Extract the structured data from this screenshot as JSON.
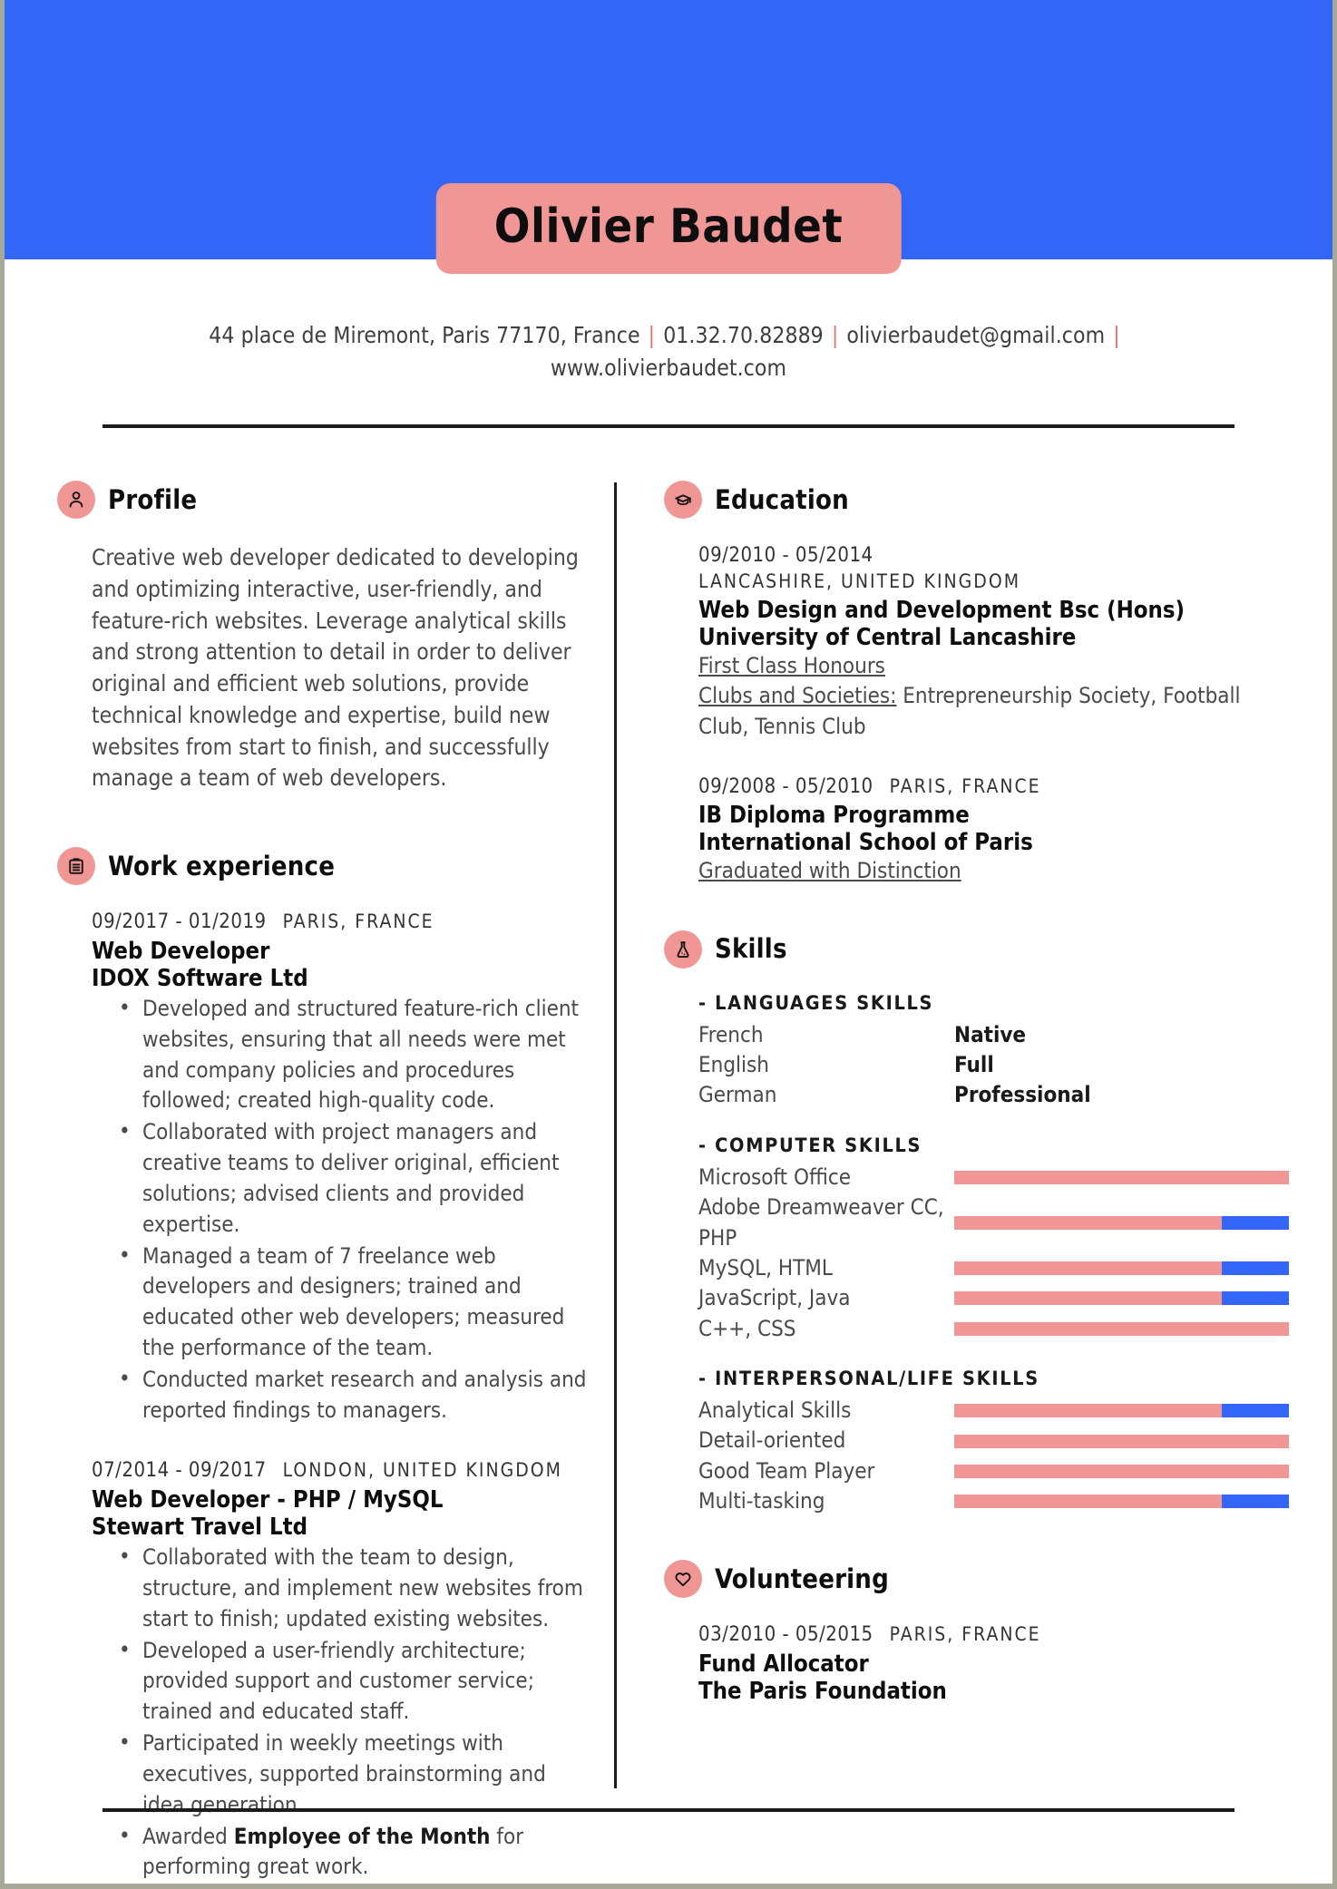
{
  "theme": {
    "accent_blue": "#3366f6",
    "accent_pink": "#f09694",
    "text_dark": "#0e0e0e",
    "text_body": "#4a4a4a",
    "separator_pink": "#e5706d"
  },
  "header": {
    "name": "Olivier Baudet",
    "contact": {
      "address": "44 place de Miremont, Paris 77170, France",
      "phone": "01.32.70.82889",
      "email": "olivierbaudet@gmail.com",
      "website": "www.olivierbaudet.com",
      "separator": "|"
    }
  },
  "profile": {
    "heading": "Profile",
    "icon": "person-icon",
    "text": "Creative web developer dedicated to developing and optimizing interactive, user-friendly, and feature-rich websites. Leverage analytical skills and strong attention to detail in order to deliver original and efficient web solutions, provide technical knowledge and expertise, build new websites from start to finish, and successfully manage a team of web developers."
  },
  "work_experience": {
    "heading": "Work experience",
    "icon": "briefcase-icon",
    "entries": [
      {
        "dates": "09/2017 - 01/2019",
        "location": "PARIS, FRANCE",
        "title": "Web Developer",
        "organization": "IDOX Software Ltd",
        "bullets": [
          {
            "text": "Developed and structured feature-rich client websites, ensuring that all needs were met and company policies and procedures followed; created high-quality code."
          },
          {
            "text": "Collaborated with project managers and creative teams to deliver original, efficient solutions; advised clients and provided expertise."
          },
          {
            "text": "Managed a team of 7 freelance web developers and designers; trained and educated other web developers; measured the performance of the team."
          },
          {
            "text": "Conducted market research and analysis and reported findings to managers."
          }
        ]
      },
      {
        "dates": "07/2014 - 09/2017",
        "location": "LONDON, UNITED KINGDOM",
        "title": "Web Developer - PHP / MySQL",
        "organization": "Stewart Travel Ltd",
        "bullets": [
          {
            "text": "Collaborated with the team to design, structure, and implement new websites from start to finish; updated existing websites."
          },
          {
            "text": "Developed a user-friendly architecture; provided support and customer service; trained and educated staff."
          },
          {
            "text": "Participated in weekly meetings with executives, supported brainstorming and idea generation."
          },
          {
            "pre": "Awarded ",
            "bold": "Employee of the Month",
            "post": " for performing great work."
          }
        ]
      }
    ]
  },
  "education": {
    "heading": "Education",
    "icon": "graduation-cap-icon",
    "entries": [
      {
        "dates": "09/2010 - 05/2014",
        "location": "LANCASHIRE, UNITED KINGDOM",
        "location_block": true,
        "title": "Web Design and Development Bsc (Hons)",
        "organization": "University of Central Lancashire",
        "note_1_underline": "First Class Honours",
        "note_2_underline": "Clubs and Societies:",
        "note_2_rest": " Entrepreneurship Society, Football Club, Tennis Club"
      },
      {
        "dates": "09/2008 - 05/2010",
        "location": "PARIS, FRANCE",
        "location_block": false,
        "title": "IB Diploma Programme",
        "organization": "International School of Paris",
        "note_1_underline": "Graduated with Distinction"
      }
    ]
  },
  "skills": {
    "heading": "Skills",
    "icon": "flask-icon",
    "groups": [
      {
        "title": "- LANGUAGES SKILLS",
        "type": "level",
        "items": [
          {
            "name": "French",
            "level": "Native"
          },
          {
            "name": "English",
            "level": "Full"
          },
          {
            "name": "German",
            "level": "Professional"
          }
        ]
      },
      {
        "title": "- COMPUTER SKILLS",
        "type": "bar",
        "items": [
          {
            "name": "Microsoft Office",
            "percent": 100
          },
          {
            "name": "Adobe Dreamweaver CC, PHP",
            "percent": 80
          },
          {
            "name": "MySQL, HTML",
            "percent": 80
          },
          {
            "name": "JavaScript, Java",
            "percent": 80
          },
          {
            "name": "C++, CSS",
            "percent": 100
          }
        ]
      },
      {
        "title": "- INTERPERSONAL/LIFE SKILLS",
        "type": "bar",
        "items": [
          {
            "name": "Analytical Skills",
            "percent": 80
          },
          {
            "name": "Detail-oriented",
            "percent": 100
          },
          {
            "name": "Good Team Player",
            "percent": 100
          },
          {
            "name": "Multi-tasking",
            "percent": 80
          }
        ]
      }
    ]
  },
  "volunteering": {
    "heading": "Volunteering",
    "icon": "heart-icon",
    "entries": [
      {
        "dates": "03/2010 - 05/2015",
        "location": "PARIS, FRANCE",
        "title": "Fund Allocator",
        "organization": "The Paris Foundation"
      }
    ]
  }
}
